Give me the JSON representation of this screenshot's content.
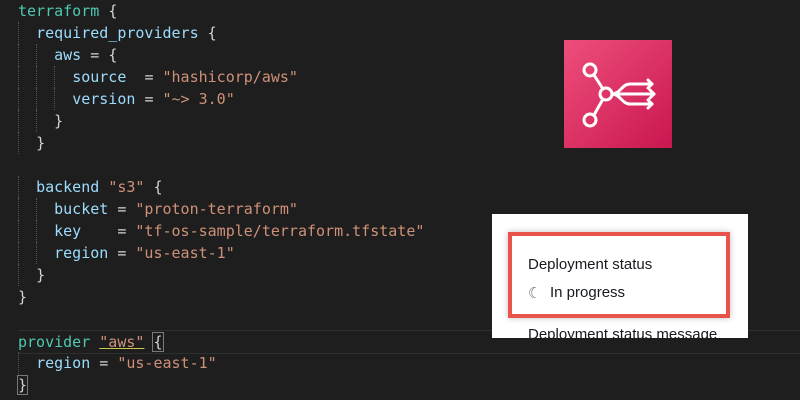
{
  "code": {
    "l1": {
      "kw": "terraform",
      "brace": "{"
    },
    "l2": {
      "ident": "required_providers",
      "brace": "{"
    },
    "l3": {
      "ident": "aws",
      "eq": "=",
      "brace": "{"
    },
    "l4": {
      "ident": "source",
      "eq": "=",
      "str": "\"hashicorp/aws\""
    },
    "l5": {
      "ident": "version",
      "eq": "=",
      "str": "\"~> 3.0\""
    },
    "l6": {
      "brace": "}"
    },
    "l7": {
      "brace": "}"
    },
    "l9": {
      "ident": "backend",
      "str": "\"s3\"",
      "brace": "{"
    },
    "l10": {
      "ident": "bucket",
      "eq": "=",
      "str": "\"proton-terraform\""
    },
    "l11": {
      "ident": "key",
      "eq": "=",
      "str": "\"tf-os-sample/terraform.tfstate\""
    },
    "l12": {
      "ident": "region",
      "eq": "=",
      "str": "\"us-east-1\""
    },
    "l13": {
      "brace": "}"
    },
    "l14": {
      "brace": "}"
    },
    "l16": {
      "kw": "provider",
      "str": "\"aws\"",
      "brace": "{"
    },
    "l17": {
      "ident": "region",
      "eq": "=",
      "str": "\"us-east-1\""
    },
    "l18": {
      "brace": "}"
    }
  },
  "logo": {
    "icon": "proton-service-icon",
    "bg_from": "#ee4e7c",
    "bg_to": "#c9174f"
  },
  "deployment": {
    "status_label": "Deployment status",
    "spinner_glyph": "☾",
    "status_value": "In progress",
    "next_label": "Deployment status message"
  },
  "colors": {
    "highlight_border": "#e8544c",
    "editor_bg": "#1e1e1e"
  }
}
